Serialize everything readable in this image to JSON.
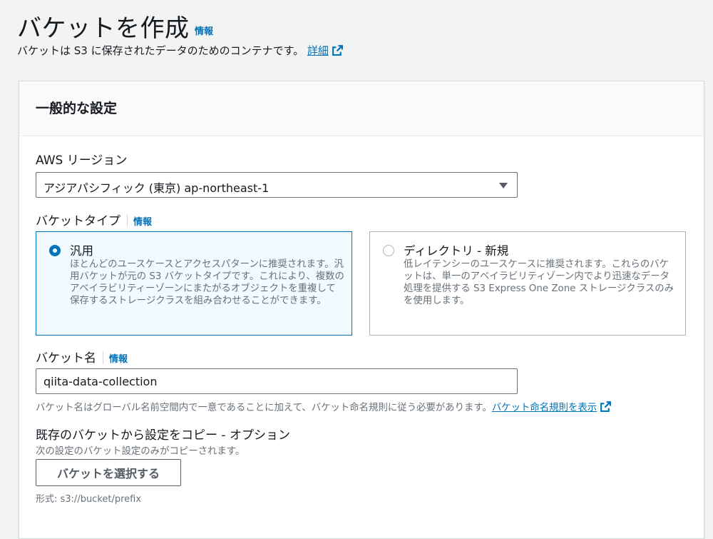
{
  "header": {
    "title": "バケットを作成",
    "info_link": "情報",
    "description": "バケットは S3 に保存されたデータのためのコンテナです。",
    "details_link": "詳細"
  },
  "general_settings": {
    "title": "一般的な設定",
    "region": {
      "label": "AWS リージョン",
      "selected_value": "アジアパシフィック (東京) ap-northeast-1"
    },
    "bucket_type": {
      "label": "バケットタイプ",
      "info_link": "情報",
      "options": [
        {
          "title": "汎用",
          "description": "ほとんどのユースケースとアクセスパターンに推奨されます。汎用バケットが元の S3 バケットタイプです。これにより、複数のアベイラビリティーゾーンにまたがるオブジェクトを重複して保存するストレージクラスを組み合わせることができます。",
          "selected": true
        },
        {
          "title": "ディレクトリ - 新規",
          "description": "低レイテンシーのユースケースに推奨されます。これらのバケットは、単一のアベイラビリティゾーン内でより迅速なデータ処理を提供する S3 Express One Zone ストレージクラスのみを使用します。",
          "selected": false
        }
      ]
    },
    "bucket_name": {
      "label": "バケット名",
      "info_link": "情報",
      "value": "qiita-data-collection",
      "hint": "バケット名はグローバル名前空間内で一意であることに加えて、バケット命名規則に従う必要があります。",
      "rules_link": "バケット命名規則を表示"
    },
    "copy_settings": {
      "label": "既存のバケットから設定をコピー - オプション",
      "description": "次の設定のバケット設定のみがコピーされます。",
      "button_label": "バケットを選択する",
      "format_hint": "形式: s3://bucket/prefix"
    }
  },
  "colors": {
    "link": "#0073bb",
    "selected_tile_bg": "#f1faff",
    "page_bg": "#f2f3f3"
  },
  "icons": {
    "external_link": "external-link-icon",
    "dropdown_caret": "caret-down-icon"
  }
}
